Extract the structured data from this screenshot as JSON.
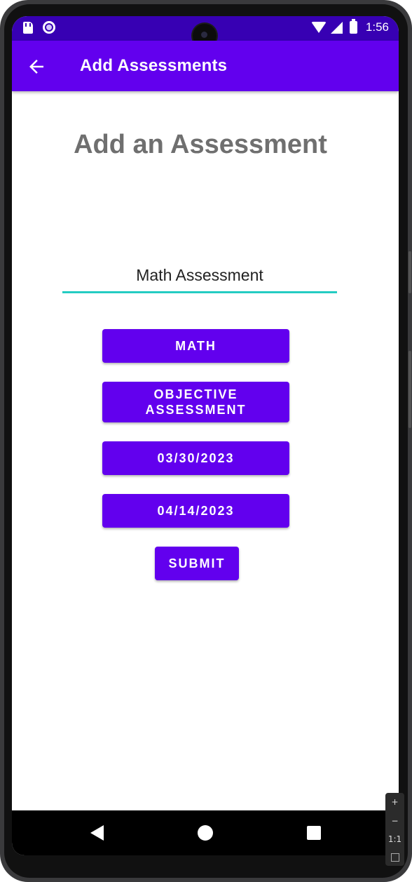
{
  "status_bar": {
    "time": "1:56",
    "left_icons": [
      "sd-card-icon",
      "record-icon"
    ],
    "right_icons": [
      "wifi-icon",
      "signal-icon",
      "battery-icon"
    ]
  },
  "app_bar": {
    "title": "Add Assessments",
    "back_icon": "arrow-left-icon"
  },
  "form": {
    "heading": "Add an Assessment",
    "name_value": "Math Assessment",
    "course_button": "MATH",
    "type_button": "OBJECTIVE ASSESSMENT",
    "start_date_button": "03/30/2023",
    "end_date_button": "04/14/2023",
    "submit_button": "SUBMIT"
  },
  "nav_bar": {
    "icons": [
      "nav-back-icon",
      "nav-home-icon",
      "nav-recents-icon"
    ]
  },
  "emulator_zoom": {
    "zoom_in": "+",
    "zoom_out": "−",
    "actual_size": "1:1"
  },
  "colors": {
    "status_bar": "#3700b3",
    "primary": "#6200ee",
    "input_underline": "#24ccc2",
    "heading_text": "#6f6f6f"
  }
}
